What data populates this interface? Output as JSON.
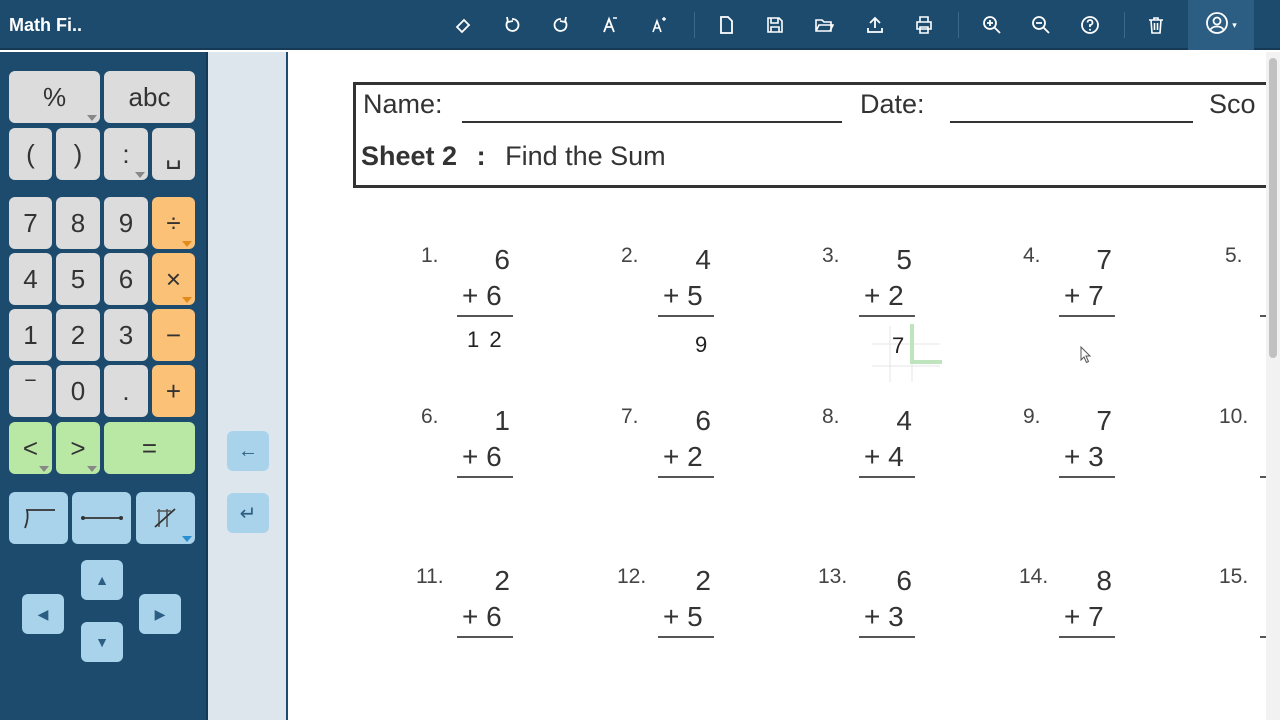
{
  "app": {
    "title": "Math Fi.."
  },
  "toolbar": {
    "icons": [
      "eraser-icon",
      "undo-icon",
      "redo-icon",
      "font-smaller-icon",
      "font-larger-icon",
      "new-page-icon",
      "save-icon",
      "open-folder-icon",
      "upload-icon",
      "print-icon",
      "zoom-in-icon",
      "zoom-out-icon",
      "help-icon",
      "trash-icon",
      "user-icon"
    ]
  },
  "keypad": {
    "percent": "%",
    "abc": "abc",
    "lparen": "(",
    "rparen": ")",
    "colon": ":",
    "space": "␣",
    "k7": "7",
    "k8": "8",
    "k9": "9",
    "div": "÷",
    "k4": "4",
    "k5": "5",
    "k6": "6",
    "mul": "×",
    "k1": "1",
    "k2": "2",
    "k3": "3",
    "minus": "−",
    "bar": "‾",
    "k0": "0",
    "dot": ".",
    "plus": "+",
    "lt": "<",
    "gt": ">",
    "eq": "=",
    "colors": {
      "orange": "#fbc176",
      "green": "#b9e8a5",
      "blue": "#a8d3ea",
      "gray": "#dcdcdc",
      "panel": "#1d4b6e"
    }
  },
  "side": {
    "backspace": "←",
    "enter": "↵"
  },
  "sheet": {
    "name_label": "Name:",
    "date_label": "Date:",
    "score_label": "Sco",
    "title_bold": "Sheet 2",
    "title_sep": ":",
    "title_rest": "Find the Sum",
    "problems": [
      {
        "num": "1.",
        "top": "6",
        "add": "+ 6",
        "answer": "1 2"
      },
      {
        "num": "2.",
        "top": "4",
        "add": "+ 5",
        "answer": "9"
      },
      {
        "num": "3.",
        "top": "5",
        "add": "+ 2",
        "answer": "7"
      },
      {
        "num": "4.",
        "top": "7",
        "add": "+ 7",
        "answer": ""
      },
      {
        "num": "5.",
        "top": "",
        "add": "",
        "answer": ""
      },
      {
        "num": "6.",
        "top": "1",
        "add": "+ 6",
        "answer": ""
      },
      {
        "num": "7.",
        "top": "6",
        "add": "+ 2",
        "answer": ""
      },
      {
        "num": "8.",
        "top": "4",
        "add": "+ 4",
        "answer": ""
      },
      {
        "num": "9.",
        "top": "7",
        "add": "+ 3",
        "answer": ""
      },
      {
        "num": "10.",
        "top": "",
        "add": "",
        "answer": ""
      },
      {
        "num": "11.",
        "top": "2",
        "add": "+ 6",
        "answer": ""
      },
      {
        "num": "12.",
        "top": "2",
        "add": "+ 5",
        "answer": ""
      },
      {
        "num": "13.",
        "top": "6",
        "add": "+ 3",
        "answer": ""
      },
      {
        "num": "14.",
        "top": "8",
        "add": "+ 7",
        "answer": ""
      },
      {
        "num": "15.",
        "top": "",
        "add": "",
        "answer": ""
      }
    ]
  }
}
